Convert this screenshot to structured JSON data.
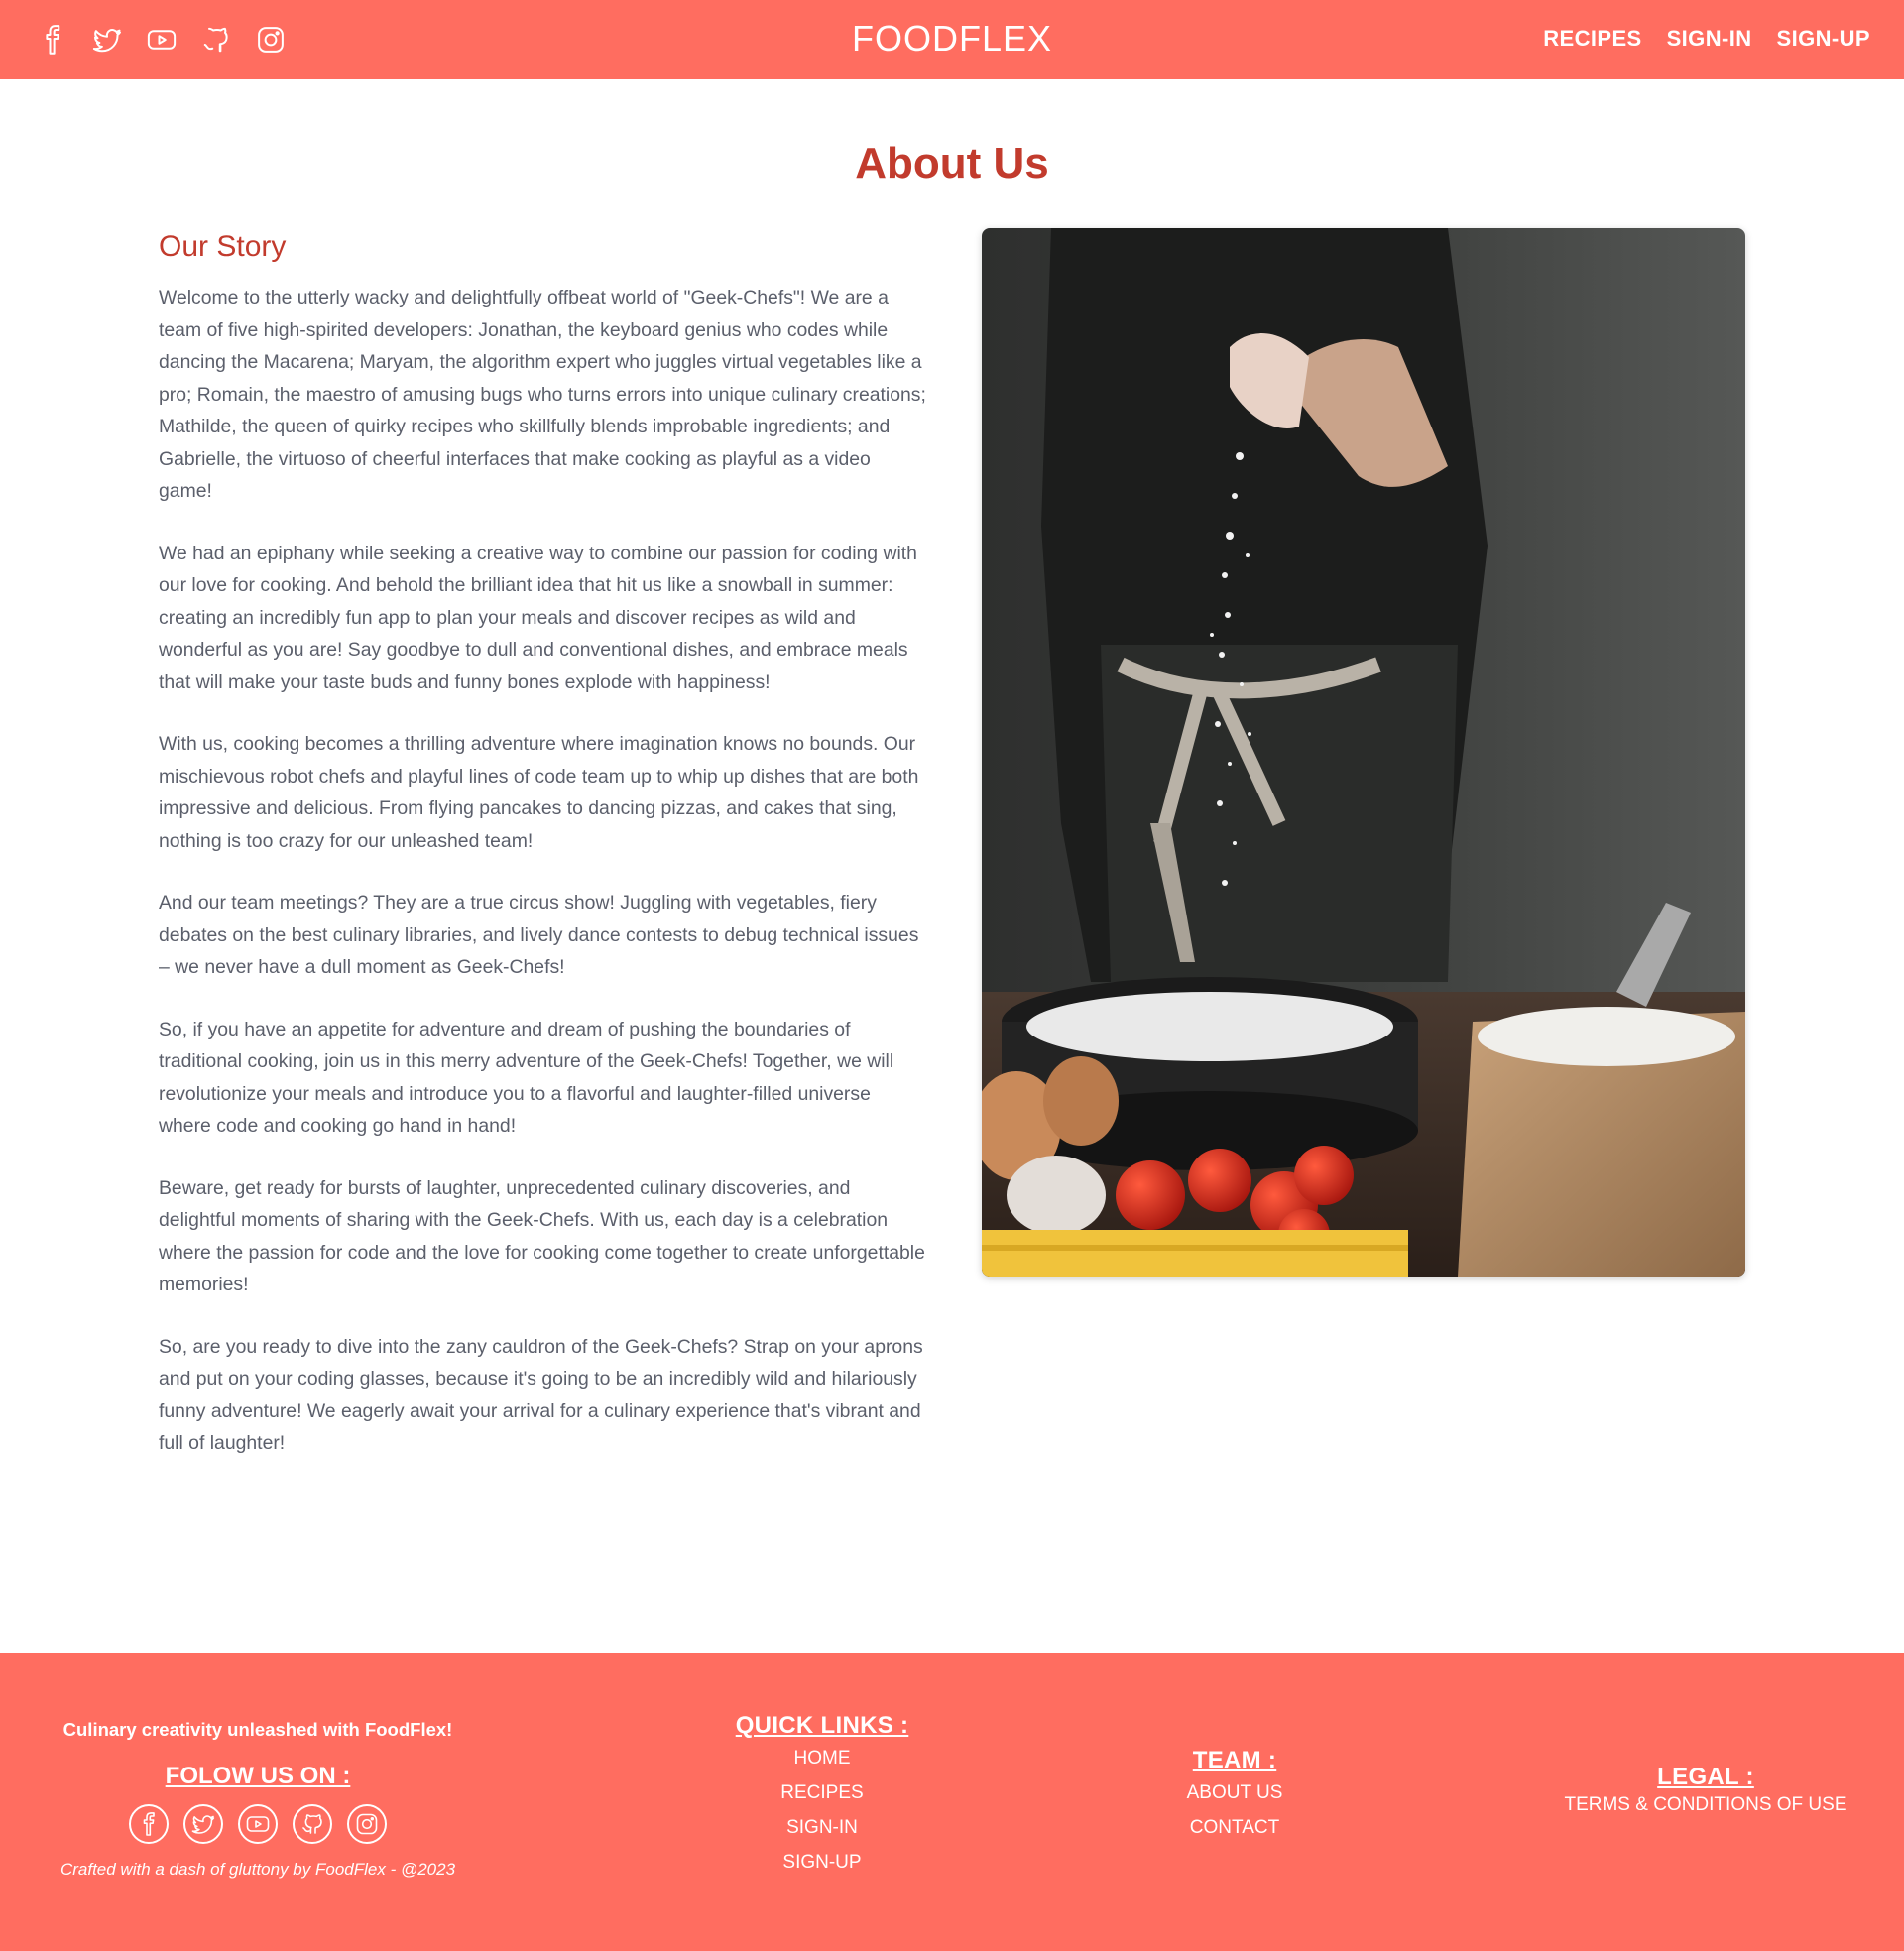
{
  "header": {
    "brand": "FOODFLEX",
    "social_icons": [
      "facebook-icon",
      "twitter-icon",
      "youtube-icon",
      "github-icon",
      "instagram-icon"
    ],
    "nav": {
      "recipes": "RECIPES",
      "sign_in": "SIGN-IN",
      "sign_up": "SIGN-UP"
    }
  },
  "main": {
    "title": "About Us",
    "story_heading": "Our Story",
    "paragraphs": [
      "Welcome to the utterly wacky and delightfully offbeat world of \"Geek-Chefs\"! We are a team of five high-spirited developers: Jonathan, the keyboard genius who codes while dancing the Macarena; Maryam, the algorithm expert who juggles virtual vegetables like a pro; Romain, the maestro of amusing bugs who turns errors into unique culinary creations; Mathilde, the queen of quirky recipes who skillfully blends improbable ingredients; and Gabrielle, the virtuoso of cheerful interfaces that make cooking as playful as a video game!",
      "We had an epiphany while seeking a creative way to combine our passion for coding with our love for cooking. And behold the brilliant idea that hit us like a snowball in summer: creating an incredibly fun app to plan your meals and discover recipes as wild and wonderful as you are! Say goodbye to dull and conventional dishes, and embrace meals that will make your taste buds and funny bones explode with happiness!",
      "With us, cooking becomes a thrilling adventure where imagination knows no bounds. Our mischievous robot chefs and playful lines of code team up to whip up dishes that are both impressive and delicious. From flying pancakes to dancing pizzas, and cakes that sing, nothing is too crazy for our unleashed team!",
      "And our team meetings? They are a true circus show! Juggling with vegetables, fiery debates on the best culinary libraries, and lively dance contests to debug technical issues – we never have a dull moment as Geek-Chefs!",
      "So, if you have an appetite for adventure and dream of pushing the boundaries of traditional cooking, join us in this merry adventure of the Geek-Chefs! Together, we will revolutionize your meals and introduce you to a flavorful and laughter-filled universe where code and cooking go hand in hand!",
      "Beware, get ready for bursts of laughter, unprecedented culinary discoveries, and delightful moments of sharing with the Geek-Chefs. With us, each day is a celebration where the passion for code and the love for cooking come together to create unforgettable memories!",
      "So, are you ready to dive into the zany cauldron of the Geek-Chefs? Strap on your aprons and put on your coding glasses, because it's going to be an incredibly wild and hilariously funny adventure! We eagerly await your arrival for a culinary experience that's vibrant and full of laughter!"
    ]
  },
  "footer": {
    "tagline": "Culinary creativity unleashed with FoodFlex!",
    "follow_title": "FOLOW US ON :",
    "crafted": "Crafted with a dash of gluttony by FoodFlex - @2023",
    "quick_links": {
      "title": "QUICK LINKS :",
      "home": "HOME",
      "recipes": "RECIPES",
      "sign_in": "SIGN-IN",
      "sign_up": "SIGN-UP"
    },
    "team": {
      "title": "TEAM :",
      "about": "ABOUT US",
      "contact": "CONTACT"
    },
    "legal": {
      "title": "LEGAL :",
      "terms": "TERMS & CONDITIONS OF USE"
    }
  },
  "colors": {
    "brand": "#ff6d60",
    "heading": "#c23b2d",
    "text": "#5b5f6b"
  }
}
